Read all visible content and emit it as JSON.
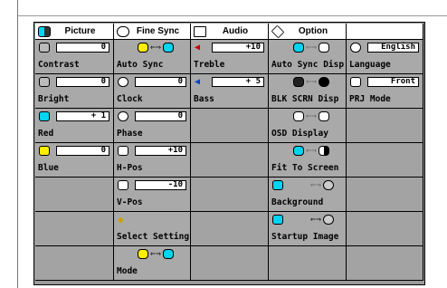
{
  "headers": [
    {
      "label": "Picture",
      "icon": "picture-icon"
    },
    {
      "label": "Fine Sync",
      "icon": "fine-sync-icon"
    },
    {
      "label": "Audio",
      "icon": "speaker-icon"
    },
    {
      "label": "Option",
      "icon": "option-icon"
    },
    {
      "label": "",
      "icon": ""
    }
  ],
  "picture": {
    "contrast": {
      "label": "Contrast",
      "value": "0"
    },
    "bright": {
      "label": "Bright",
      "value": "0"
    },
    "red": {
      "label": "Red",
      "value": "+ 1"
    },
    "blue": {
      "label": "Blue",
      "value": "0"
    }
  },
  "finesync": {
    "auto_sync": {
      "label": "Auto Sync"
    },
    "clock": {
      "label": "Clock",
      "value": "0"
    },
    "phase": {
      "label": "Phase",
      "value": "0"
    },
    "hpos": {
      "label": "H-Pos",
      "value": "+10"
    },
    "vpos": {
      "label": "V-Pos",
      "value": "-10"
    },
    "select_setting": {
      "label": "Select Setting"
    },
    "mode": {
      "label": "Mode"
    }
  },
  "audio": {
    "treble": {
      "label": "Treble",
      "value": "+10"
    },
    "bass": {
      "label": "Bass",
      "value": "+ 5"
    }
  },
  "option": {
    "auto_sync_disp": {
      "label": "Auto Sync Disp"
    },
    "blk_scrn_disp": {
      "label": "BLK SCRN Disp"
    },
    "osd_display": {
      "label": "OSD Display"
    },
    "fit_to_screen": {
      "label": "Fit To Screen"
    },
    "background": {
      "label": "Background"
    },
    "startup_image": {
      "label": "Startup Image"
    }
  },
  "extra": {
    "language": {
      "label": "Language",
      "value": "English"
    },
    "prj_mode": {
      "label": "PRJ Mode",
      "value": "Front"
    }
  },
  "colors": {
    "yellow": "#ffee00",
    "cyan": "#00d4f0",
    "cell": "#a9a9a9"
  }
}
